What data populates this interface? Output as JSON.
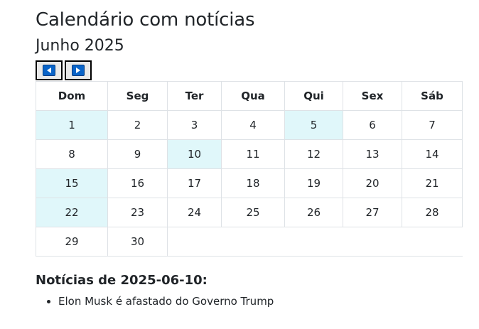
{
  "page": {
    "title": "Calendário com notícias",
    "month_label": "Junho 2025"
  },
  "nav": {
    "prev_icon": "left-arrow-icon",
    "next_icon": "right-arrow-icon"
  },
  "calendar": {
    "weekdays": [
      "Dom",
      "Seg",
      "Ter",
      "Qua",
      "Qui",
      "Sex",
      "Sáb"
    ],
    "weeks": [
      [
        "1",
        "2",
        "3",
        "4",
        "5",
        "6",
        "7"
      ],
      [
        "8",
        "9",
        "10",
        "11",
        "12",
        "13",
        "14"
      ],
      [
        "15",
        "16",
        "17",
        "18",
        "19",
        "20",
        "21"
      ],
      [
        "22",
        "23",
        "24",
        "25",
        "26",
        "27",
        "28"
      ],
      [
        "29",
        "30",
        "",
        "",
        "",
        "",
        ""
      ]
    ],
    "news_days": [
      "1",
      "5",
      "10",
      "15",
      "22"
    ],
    "highlight_color": "#e0f7fa"
  },
  "news": {
    "heading": "Notícias de 2025-06-10:",
    "items": [
      "Elon Musk é afastado do Governo Trump"
    ]
  }
}
